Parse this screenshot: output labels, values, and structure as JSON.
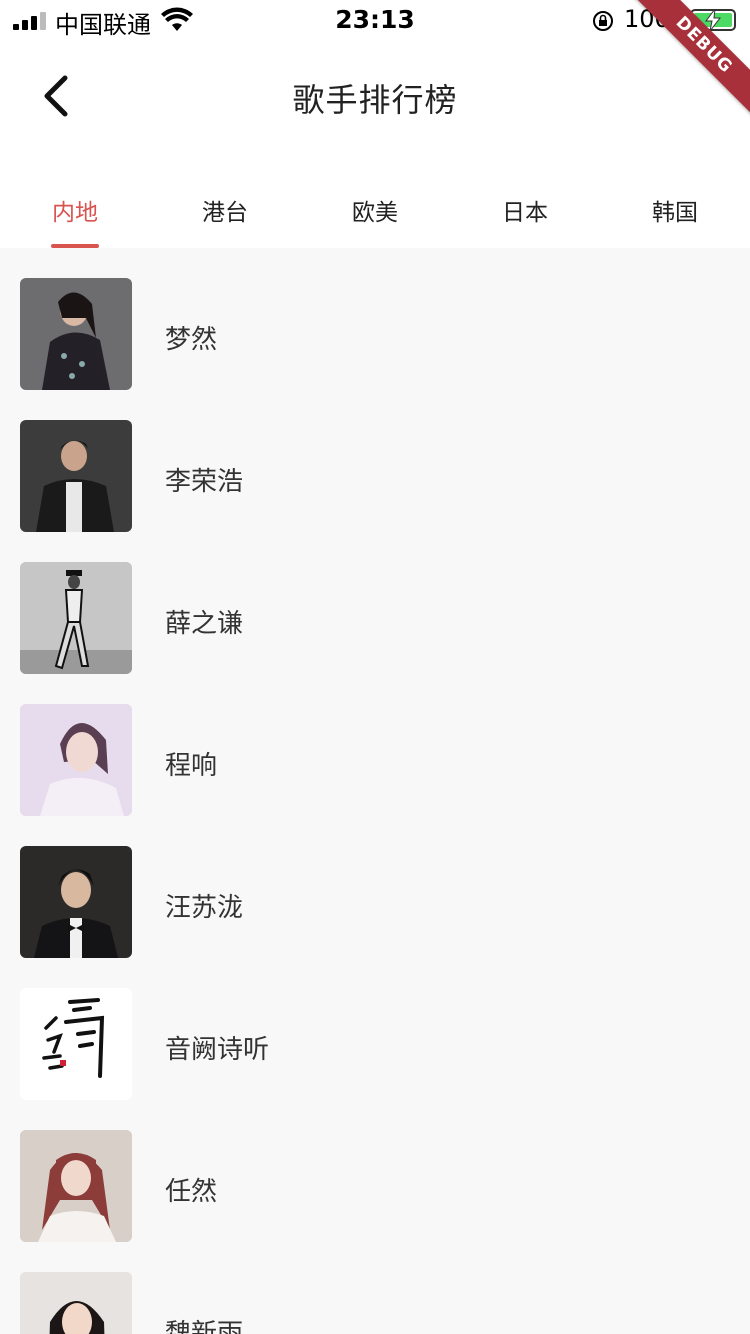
{
  "status_bar": {
    "carrier": "中国联通",
    "time": "23:13",
    "battery_percent": "100%",
    "battery_level": 1.0
  },
  "header": {
    "title": "歌手排行榜",
    "back_icon": "chevron-left-icon"
  },
  "tabs": [
    {
      "label": "内地",
      "active": true
    },
    {
      "label": "港台",
      "active": false
    },
    {
      "label": "欧美",
      "active": false
    },
    {
      "label": "日本",
      "active": false
    },
    {
      "label": "韩国",
      "active": false
    }
  ],
  "singers": [
    {
      "name": "梦然"
    },
    {
      "name": "李荣浩"
    },
    {
      "name": "薛之谦"
    },
    {
      "name": "程响"
    },
    {
      "name": "汪苏泷"
    },
    {
      "name": "音阙诗听"
    },
    {
      "name": "任然"
    },
    {
      "name": "魏新雨"
    }
  ],
  "debug_banner": "DEBUG",
  "colors": {
    "accent": "#d9534f",
    "background": "#f8f8f8",
    "banner": "#a8303a"
  }
}
